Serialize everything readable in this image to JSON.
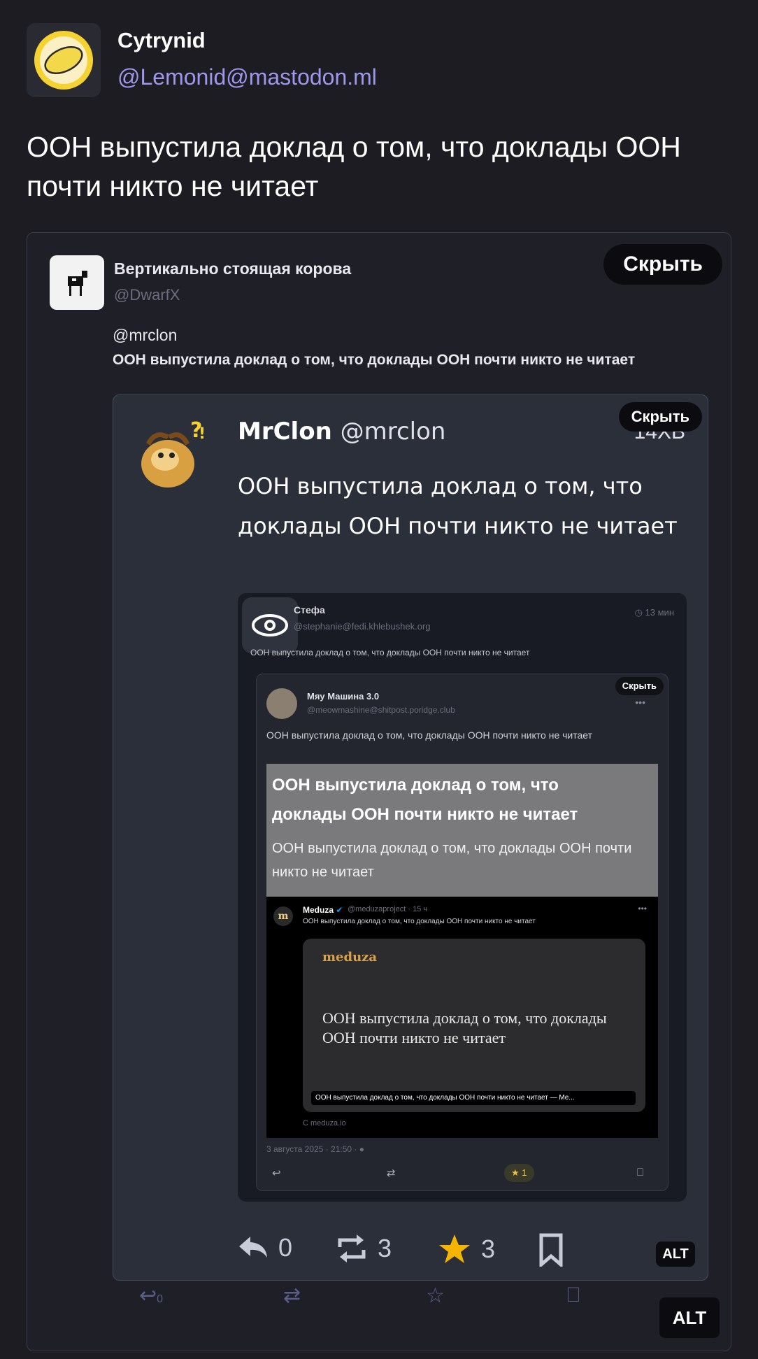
{
  "post": {
    "display_name": "Cytrynid",
    "handle": "@Lemonid@mastodon.ml",
    "text": "ООН выпустила доклад о том, что доклады ООН почти никто не читает"
  },
  "attachment": {
    "hide_label": "Скрыть",
    "alt_label": "ALT",
    "cow_post": {
      "display_name": "Вертикально стоящая корова",
      "handle": "@DwarfX",
      "mention": "@mrclon",
      "text": "ООН выпустила доклад о том, что доклады ООН почти никто не читает"
    },
    "mrclon_post": {
      "display_name": "MrClon",
      "handle": "@mrclon",
      "time": "14ХВ",
      "hide_label": "Скрыть",
      "text": "ООН выпустила доклад о том, что доклады ООН почти никто не читает",
      "alt_label": "ALT",
      "counts": {
        "reply": "0",
        "boost": "3",
        "fav": "3"
      }
    },
    "stefa_post": {
      "display_name": "Стефа",
      "handle": "@stephanie@fedi.khlebushek.org",
      "time": "13 мин",
      "text": "ООН выпустила доклад о том, что доклады ООН почти никто не читает"
    },
    "meow_post": {
      "display_name": "Мяу Машина 3.0",
      "handle": "@meowmashine@shitpost.poridge.club",
      "hide_label": "Скрыть",
      "dots": "•••",
      "text": "ООН выпустила доклад о том, что доклады ООН почти никто не читает",
      "card_title": "ООН выпустила доклад о том, что доклады ООН почти никто не читает",
      "card_subtitle": "ООН выпустила доклад о том, что доклады ООН почти никто не читает",
      "date": "3 августа 2025 · 21:50 · ●",
      "fav_count": "1"
    },
    "meduza_post": {
      "logo": "m",
      "display_name": "Meduza",
      "handle": "@meduzaproject · 15 ч",
      "dots": "•••",
      "text": "ООН выпустила доклад о том, что доклады ООН почти никто не читает",
      "brand": "meduza",
      "headline": "ООН выпустила доклад о том, что доклады ООН почти никто не читает",
      "caption": "ООН выпустила доклад о том, что доклады ООН почти никто не читает — Me...",
      "source": "С meduza.io"
    },
    "outer_counts": {
      "reply": "0"
    }
  },
  "colors": {
    "background": "#1c1c22",
    "handle": "#9e97ea",
    "fav": "#f5b400"
  }
}
